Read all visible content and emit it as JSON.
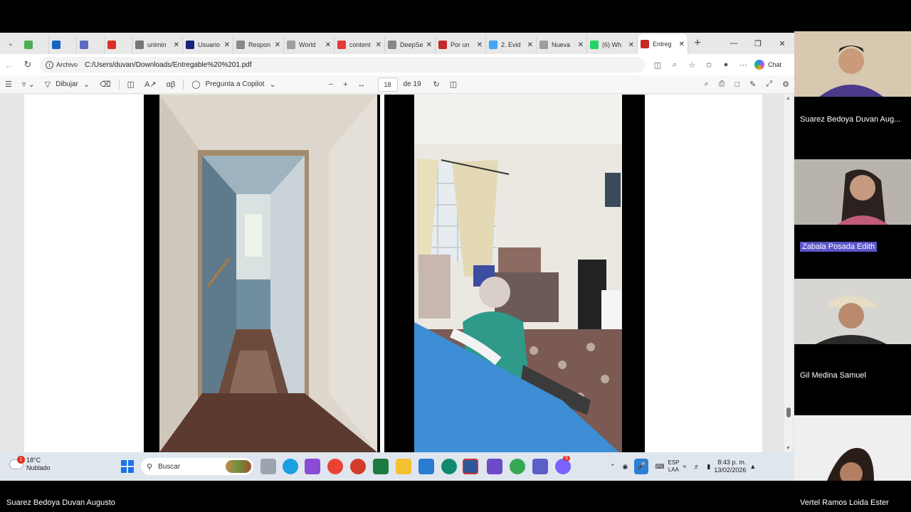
{
  "browser": {
    "tabs": [
      {
        "label": "",
        "icon": "meet-icon",
        "color": "#4caf50",
        "small": true
      },
      {
        "label": "",
        "icon": "outlook-icon",
        "color": "#1565c0",
        "small": true
      },
      {
        "label": "",
        "icon": "mail-icon",
        "color": "#5c6bc0",
        "small": true
      },
      {
        "label": "",
        "icon": "gmail-icon",
        "color": "#d93025",
        "small": true
      },
      {
        "label": "unimin",
        "icon": "search-icon",
        "color": "#777777",
        "small": false
      },
      {
        "label": "Usuario",
        "icon": "moodle-icon",
        "color": "#1a237e",
        "small": false
      },
      {
        "label": "Respon",
        "icon": "globe-icon",
        "color": "#888888",
        "small": false
      },
      {
        "label": "World",
        "icon": "world-icon",
        "color": "#9e9e9e",
        "small": false
      },
      {
        "label": "content",
        "icon": "doc-icon",
        "color": "#e53935",
        "small": false
      },
      {
        "label": "DeepSe",
        "icon": "globe-icon",
        "color": "#888888",
        "small": false
      },
      {
        "label": "Por un",
        "icon": "pdf-icon",
        "color": "#c62828",
        "small": false
      },
      {
        "label": "2. Evid",
        "icon": "cloud-icon",
        "color": "#42a5f5",
        "small": false
      },
      {
        "label": "Nueva",
        "icon": "page-icon",
        "color": "#9e9e9e",
        "small": false
      },
      {
        "label": "(6) Wh",
        "icon": "whatsapp-icon",
        "color": "#25d366",
        "small": false
      },
      {
        "label": "Entreg",
        "icon": "pdf-icon",
        "color": "#c62828",
        "small": false,
        "active": true
      }
    ],
    "address": {
      "scheme_label": "Archivo",
      "url": "C:/Users/duvan/Downloads/Entregable%20%201.pdf"
    },
    "chat_label": "Chat"
  },
  "pdf_toolbar": {
    "draw_label": "Dibujar",
    "copilot_label": "Pregunta a Copilot",
    "page_current": "18",
    "page_of": "de 19"
  },
  "taskbar": {
    "weather_temp": "18°C",
    "weather_desc": "Nublado",
    "weather_badge": "1",
    "search_placeholder": "Buscar",
    "lang_top": "ESP",
    "lang_bottom": "LAA",
    "time": "8:43 p. m.",
    "date": "13/02/2026",
    "teams_badge": "5"
  },
  "participants": [
    {
      "name": "Suarez Bedoya Duvan Aug...",
      "highlight": false
    },
    {
      "name": "Zabala Posada Edith",
      "highlight": true
    },
    {
      "name": "Gil Medina Samuel",
      "highlight": false
    },
    {
      "name": "Vertel Ramos Loida Ester",
      "highlight": false
    }
  ],
  "presenter_name": "Suarez Bedoya Duvan Augusto"
}
